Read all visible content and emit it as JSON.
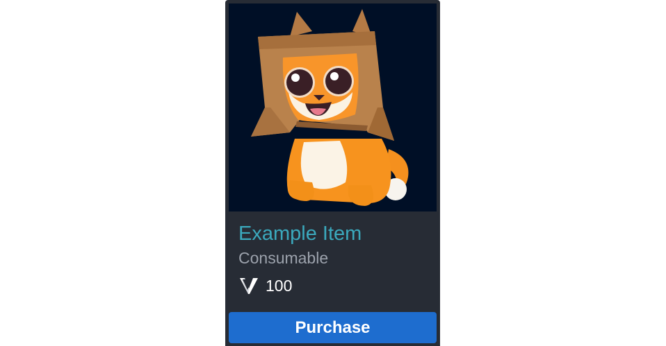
{
  "item": {
    "name": "Example Item",
    "type": "Consumable",
    "price": "100",
    "image_icon": "cat-in-box-icon",
    "currency_icon": "v-currency-icon"
  },
  "actions": {
    "purchase_label": "Purchase"
  },
  "colors": {
    "card_bg": "#272c35",
    "image_bg": "#000f26",
    "title": "#3ba9bd",
    "subtitle": "#9ca2ac",
    "button": "#1e6dcf"
  }
}
